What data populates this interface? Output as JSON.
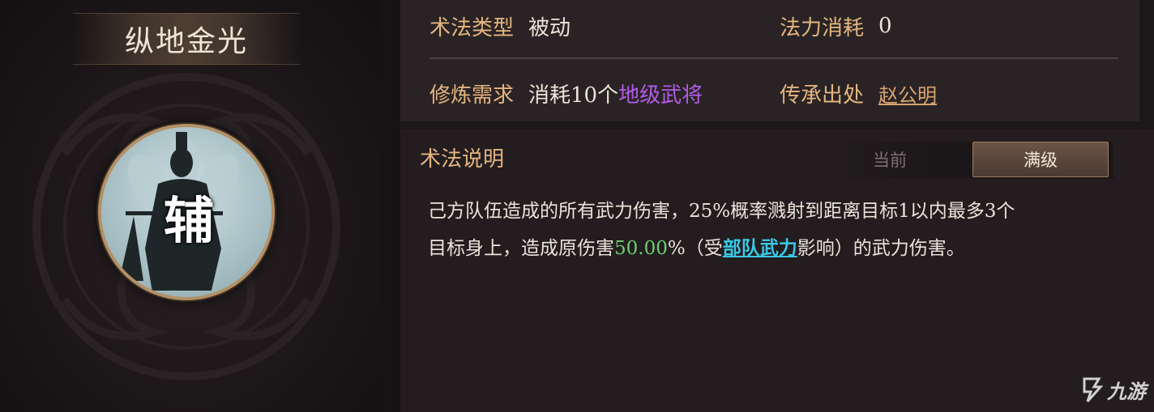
{
  "skill": {
    "name": "纵地金光",
    "role_char": "辅"
  },
  "info": {
    "type_label": "术法类型",
    "type_value": "被动",
    "cost_label": "法力消耗",
    "cost_value": "0",
    "req_label": "修炼需求",
    "req_prefix": "消耗10个",
    "req_highlight": "地级武将",
    "origin_label": "传承出处",
    "origin_value": "赵公明"
  },
  "description": {
    "title": "术法说明",
    "tabs": [
      "当前",
      "满级"
    ],
    "active_tab": "满级",
    "line1": "己方队伍造成的所有武力伤害，25%概率溅射到距离目标1以内最多3个",
    "line2_a": "目标身上，造成原伤害",
    "line2_pct": "50.00",
    "line2_b": "%（受",
    "line2_link": "部队武力",
    "line2_c": "影响）的武力伤害。"
  },
  "watermark": "九游",
  "colors": {
    "label": "#e4b57e",
    "purple_highlight": "#b25ce6",
    "green_value": "#6fcf6b",
    "cyan_link": "#39c9e6"
  }
}
